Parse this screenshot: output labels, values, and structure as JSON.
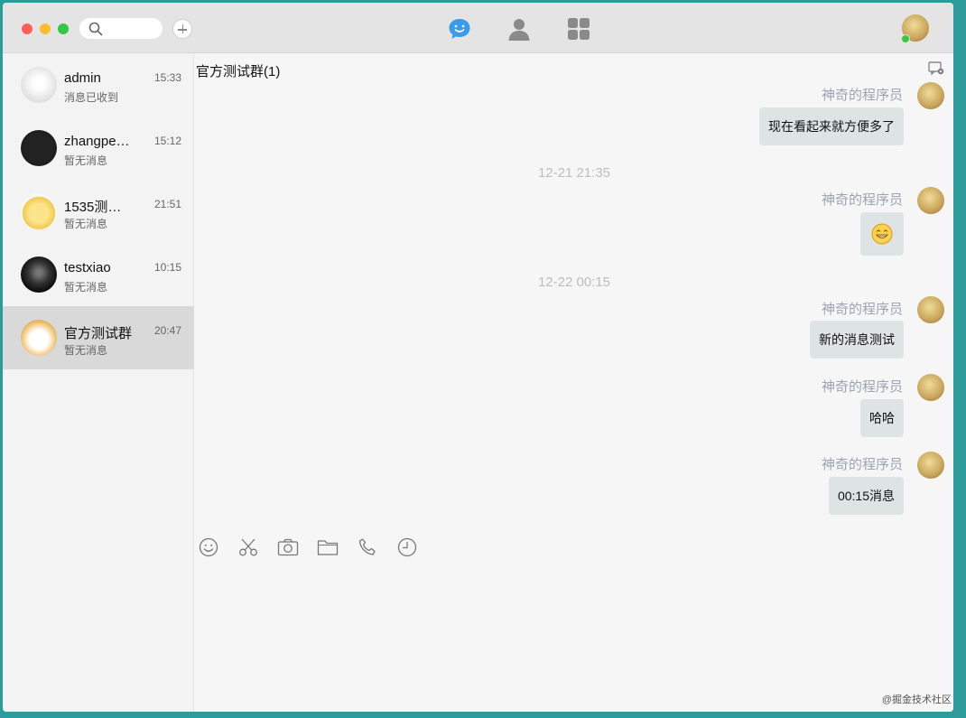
{
  "topbar": {
    "search_icon": "search-icon",
    "add_icon": "plus-icon",
    "nav": [
      {
        "name": "chat",
        "icon": "chat-bubble-icon",
        "color": "#3a9be8"
      },
      {
        "name": "contacts",
        "icon": "person-icon",
        "color": "#8a8a8a"
      },
      {
        "name": "apps",
        "icon": "grid-icon",
        "color": "#8a8a8a"
      }
    ]
  },
  "sidebar": {
    "conversations": [
      {
        "name": "admin",
        "time": "15:33",
        "preview": "消息已收到"
      },
      {
        "name": "zhangpe…",
        "time": "15:12",
        "preview": "暂无消息"
      },
      {
        "name": "1535测…",
        "time": "21:51",
        "preview": "暂无消息"
      },
      {
        "name": "testxiao",
        "time": "10:15",
        "preview": "暂无消息"
      },
      {
        "name": "官方测试群",
        "time": "20:47",
        "preview": "暂无消息"
      }
    ]
  },
  "chat": {
    "title": "官方测试群(1)",
    "timestamps": [
      "12-21 21:35",
      "12-22 00:15"
    ],
    "messages": [
      {
        "sender": "神奇的程序员",
        "text": "现在看起来就方便多了"
      },
      {
        "sender": "神奇的程序员",
        "text": "😁"
      },
      {
        "sender": "神奇的程序员",
        "text": "新的消息测试"
      },
      {
        "sender": "神奇的程序员",
        "text": "哈哈"
      },
      {
        "sender": "神奇的程序员",
        "text": "00:15消息"
      }
    ],
    "toolbar": [
      "smile-icon",
      "scissors-icon",
      "camera-icon",
      "folder-icon",
      "phone-icon",
      "clock-icon"
    ]
  },
  "watermark": "@掘金技术社区",
  "colors": {
    "accent": "#3a9be8",
    "bubble": "#dde4e3",
    "sender": "#9ba4b2",
    "background": "#2e9b9b"
  }
}
